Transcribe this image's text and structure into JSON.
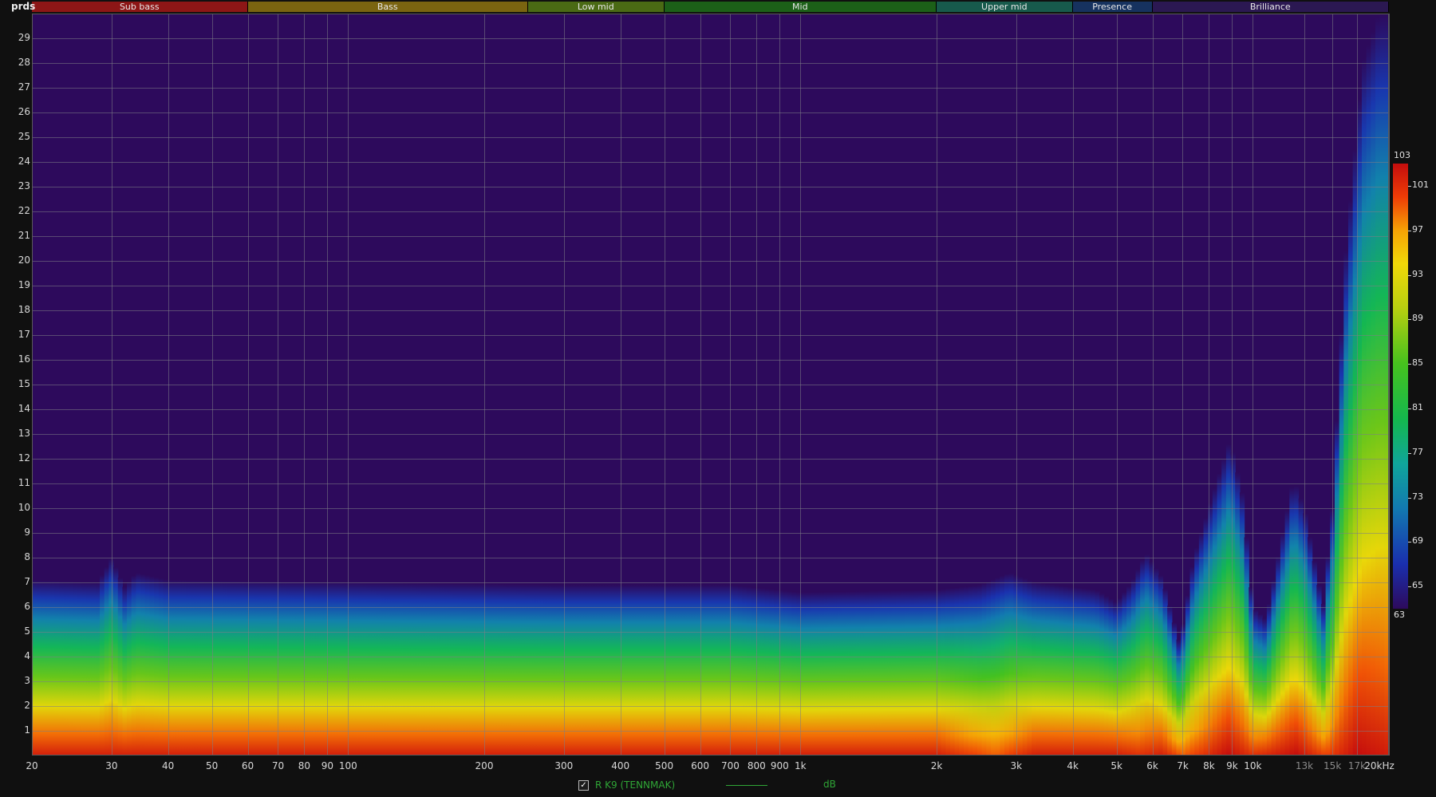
{
  "yaxis_unit": "prds",
  "bands": [
    {
      "label": "Sub bass",
      "from": 20,
      "to": 60,
      "color": "#8d1616"
    },
    {
      "label": "Bass",
      "from": 60,
      "to": 250,
      "color": "#7a6410"
    },
    {
      "label": "Low mid",
      "from": 250,
      "to": 500,
      "color": "#4a6a14"
    },
    {
      "label": "Mid",
      "from": 500,
      "to": 2000,
      "color": "#1c6018"
    },
    {
      "label": "Upper mid",
      "from": 2000,
      "to": 4000,
      "color": "#175a4c"
    },
    {
      "label": "Presence",
      "from": 4000,
      "to": 6000,
      "color": "#16325f"
    },
    {
      "label": "Brilliance",
      "from": 6000,
      "to": 20000,
      "color": "#2b1852"
    }
  ],
  "legend": {
    "label": "R K9 (TENNMAK)",
    "units": "dB",
    "checked": "✓"
  },
  "chart_data": {
    "type": "heatmap",
    "title": "",
    "xlabel": "",
    "ylabel": "prds",
    "x_scale": "log",
    "xlim": [
      20,
      20000
    ],
    "ylim": [
      0,
      30
    ],
    "grid": true,
    "x_ticks": [
      {
        "v": 20,
        "label": "20"
      },
      {
        "v": 30,
        "label": "30"
      },
      {
        "v": 40,
        "label": "40"
      },
      {
        "v": 50,
        "label": "50"
      },
      {
        "v": 60,
        "label": "60"
      },
      {
        "v": 70,
        "label": "70"
      },
      {
        "v": 80,
        "label": "80"
      },
      {
        "v": 90,
        "label": "90"
      },
      {
        "v": 100,
        "label": "100"
      },
      {
        "v": 200,
        "label": "200"
      },
      {
        "v": 300,
        "label": "300"
      },
      {
        "v": 400,
        "label": "400"
      },
      {
        "v": 500,
        "label": "500"
      },
      {
        "v": 600,
        "label": "600"
      },
      {
        "v": 700,
        "label": "700"
      },
      {
        "v": 800,
        "label": "800"
      },
      {
        "v": 900,
        "label": "900"
      },
      {
        "v": 1000,
        "label": "1k"
      },
      {
        "v": 2000,
        "label": "2k"
      },
      {
        "v": 3000,
        "label": "3k"
      },
      {
        "v": 4000,
        "label": "4k"
      },
      {
        "v": 5000,
        "label": "5k"
      },
      {
        "v": 6000,
        "label": "6k"
      },
      {
        "v": 7000,
        "label": "7k"
      },
      {
        "v": 8000,
        "label": "8k"
      },
      {
        "v": 9000,
        "label": "9k"
      },
      {
        "v": 10000,
        "label": "10k"
      },
      {
        "v": 13000,
        "label": "13k",
        "dim": true
      },
      {
        "v": 15000,
        "label": "15k",
        "dim": true
      },
      {
        "v": 17000,
        "label": "17k",
        "dim": true
      },
      {
        "v": 20000,
        "label": "20kHz"
      }
    ],
    "y_ticks": [
      1,
      2,
      3,
      4,
      5,
      6,
      7,
      8,
      9,
      10,
      11,
      12,
      13,
      14,
      15,
      16,
      17,
      18,
      19,
      20,
      21,
      22,
      23,
      24,
      25,
      26,
      27,
      28,
      29
    ],
    "colorbar": {
      "min": 63,
      "max": 103,
      "unit": "dB",
      "ticks": [
        103,
        101,
        97,
        93,
        89,
        85,
        81,
        77,
        73,
        69,
        65,
        63
      ],
      "stops": [
        {
          "db": 63,
          "color": "#2d0a5c"
        },
        {
          "db": 67,
          "color": "#1a2fae"
        },
        {
          "db": 72,
          "color": "#1279b0"
        },
        {
          "db": 76,
          "color": "#10a59b"
        },
        {
          "db": 80,
          "color": "#14b84e"
        },
        {
          "db": 85,
          "color": "#46c21e"
        },
        {
          "db": 90,
          "color": "#b8cf10"
        },
        {
          "db": 94,
          "color": "#f0d808"
        },
        {
          "db": 97,
          "color": "#f5a205"
        },
        {
          "db": 100,
          "color": "#ef3c06"
        },
        {
          "db": 103,
          "color": "#c40d0d"
        }
      ]
    },
    "ridge_top": [
      {
        "f": 20,
        "t": 7.1
      },
      {
        "f": 28,
        "t": 7.0
      },
      {
        "f": 30,
        "t": 8.0
      },
      {
        "f": 32,
        "t": 6.8
      },
      {
        "f": 34,
        "t": 7.4
      },
      {
        "f": 40,
        "t": 7.1
      },
      {
        "f": 100,
        "t": 7.0
      },
      {
        "f": 300,
        "t": 6.9
      },
      {
        "f": 700,
        "t": 6.9
      },
      {
        "f": 1000,
        "t": 6.6
      },
      {
        "f": 2000,
        "t": 6.7
      },
      {
        "f": 2500,
        "t": 6.9
      },
      {
        "f": 2900,
        "t": 7.4
      },
      {
        "f": 3300,
        "t": 7.0
      },
      {
        "f": 4500,
        "t": 6.7
      },
      {
        "f": 5000,
        "t": 6.2
      },
      {
        "f": 5400,
        "t": 7.0
      },
      {
        "f": 5800,
        "t": 8.2
      },
      {
        "f": 6300,
        "t": 7.2
      },
      {
        "f": 6900,
        "t": 4.5
      },
      {
        "f": 7400,
        "t": 8.0
      },
      {
        "f": 8300,
        "t": 11.0
      },
      {
        "f": 8900,
        "t": 12.8
      },
      {
        "f": 9500,
        "t": 10.5
      },
      {
        "f": 10000,
        "t": 6.0
      },
      {
        "f": 10700,
        "t": 5.5
      },
      {
        "f": 11500,
        "t": 8.5
      },
      {
        "f": 12300,
        "t": 11.2
      },
      {
        "f": 13000,
        "t": 10.0
      },
      {
        "f": 14300,
        "t": 6.0
      },
      {
        "f": 15000,
        "t": 10.0
      },
      {
        "f": 16000,
        "t": 20.0
      },
      {
        "f": 17500,
        "t": 28.0
      },
      {
        "f": 19000,
        "t": 30.0
      },
      {
        "f": 20000,
        "t": 30.0
      }
    ],
    "peak_level": [
      {
        "f": 20,
        "db": 102
      },
      {
        "f": 2000,
        "db": 102
      },
      {
        "f": 2700,
        "db": 99
      },
      {
        "f": 3300,
        "db": 102
      },
      {
        "f": 5000,
        "db": 102
      },
      {
        "f": 5600,
        "db": 101
      },
      {
        "f": 6300,
        "db": 102
      },
      {
        "f": 7000,
        "db": 99
      },
      {
        "f": 8800,
        "db": 103
      },
      {
        "f": 10000,
        "db": 101
      },
      {
        "f": 12500,
        "db": 103
      },
      {
        "f": 14500,
        "db": 100
      },
      {
        "f": 17000,
        "db": 103
      },
      {
        "f": 20000,
        "db": 102
      }
    ]
  }
}
